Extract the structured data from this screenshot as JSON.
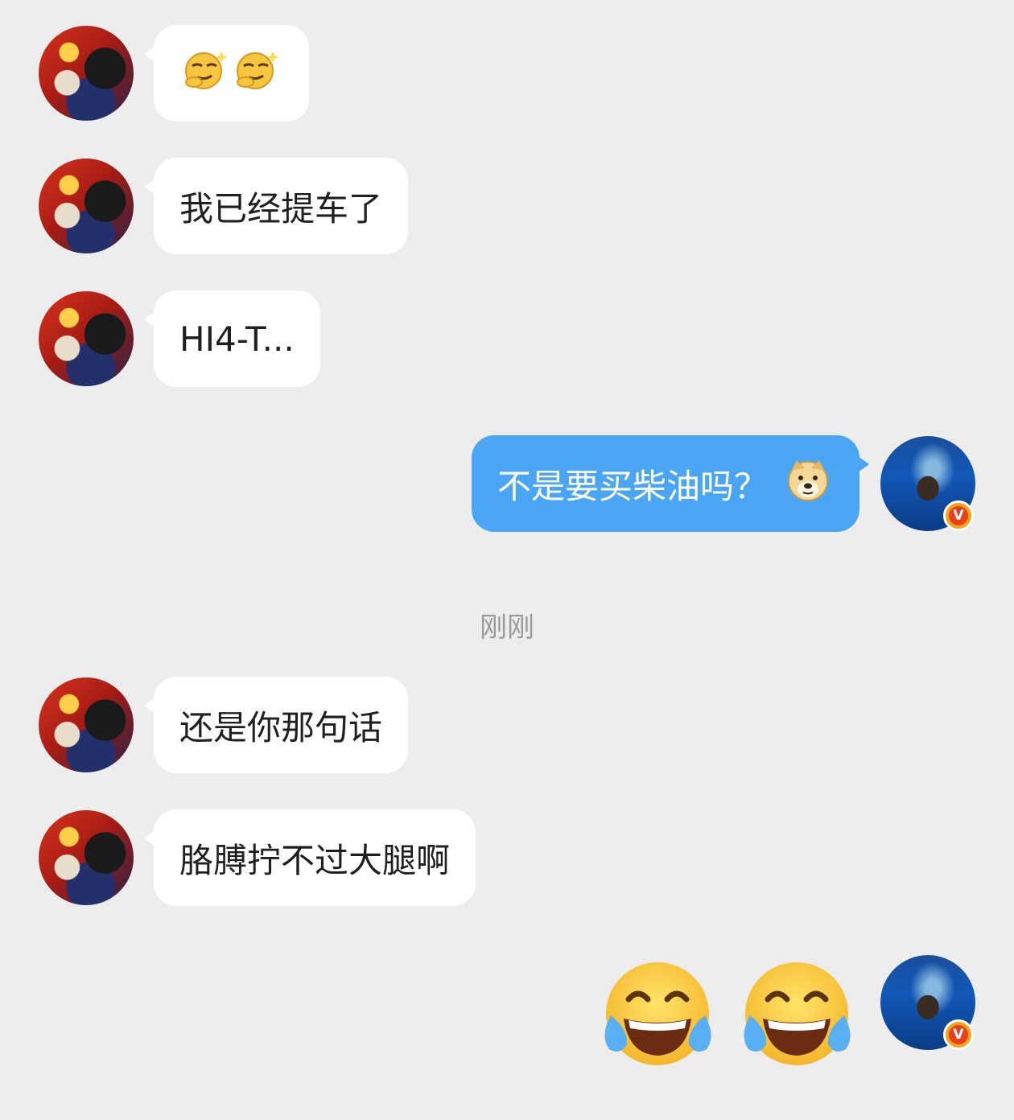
{
  "messages": [
    {
      "side": "incoming",
      "type": "emoji",
      "emojis": [
        "smirk-sparkle-emoji",
        "smirk-sparkle-emoji"
      ]
    },
    {
      "side": "incoming",
      "type": "text",
      "text": "我已经提车了"
    },
    {
      "side": "incoming",
      "type": "text",
      "text": "HI4-T..."
    },
    {
      "side": "outgoing",
      "type": "text",
      "text": "不是要买柴油吗？",
      "trailing_emoji": "doge-emoji"
    },
    {
      "side": "incoming",
      "type": "text",
      "text": "还是你那句话"
    },
    {
      "side": "incoming",
      "type": "text",
      "text": "胳膊拧不过大腿啊"
    },
    {
      "side": "outgoing",
      "type": "emoji",
      "emojis": [
        "tears-of-joy-emoji",
        "tears-of-joy-emoji"
      ]
    }
  ],
  "timestamp": "刚刚",
  "verified_badge": "V",
  "colors": {
    "background": "#ededed",
    "incoming_bubble": "#ffffff",
    "outgoing_bubble": "#4aa5f4",
    "timestamp_text": "#9a9a9a"
  }
}
